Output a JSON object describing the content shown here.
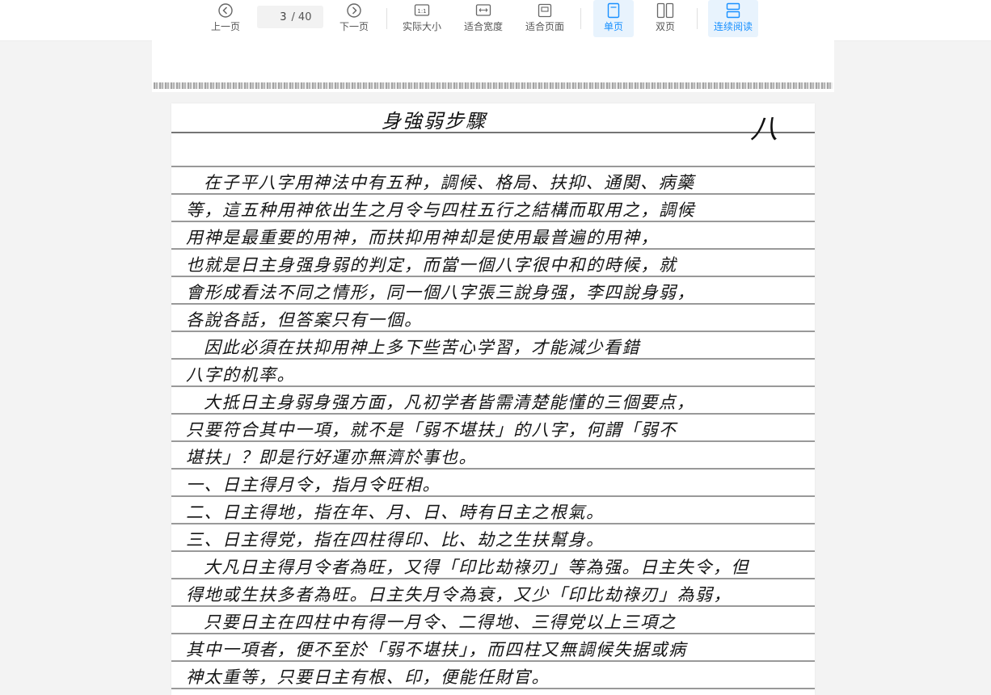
{
  "toolbar": {
    "prev_label": "上一页",
    "next_label": "下一页",
    "current_page": "3",
    "separator": "/",
    "total_pages": "40",
    "actual_size_label": "实际大小",
    "actual_size_glyph": "1:1",
    "fit_width_label": "适合宽度",
    "fit_page_label": "适合页面",
    "single_page_label": "单页",
    "double_page_label": "双页",
    "continuous_label": "连续阅读",
    "active_mode": "单页",
    "accent_color": "#1890ff"
  },
  "document": {
    "title": "身強弱步驟",
    "page_number": "八",
    "lines": [
      "在子平八字用神法中有五种，調候、格局、扶抑、通関、病藥",
      "等，這五种用神依出生之月令与四柱五行之結構而取用之，調候",
      "用神是最重要的用神，而扶抑用神却是使用最普遍的用神，",
      "也就是日主身强身弱的判定，而當一個八字很中和的時候，就",
      "會形成看法不同之情形，同一個八字張三說身强，李四說身弱，",
      "各說各話，但答案只有一個。",
      "因此必須在扶抑用神上多下些苦心学習，才能減少看錯",
      "八字的机率。",
      "大抵日主身弱身强方面，凡初学者皆需清楚能懂的三個要点，",
      "只要符合其中一項，就不是「弱不堪扶」的八字，何謂「弱不",
      "堪扶」？即是行好運亦無濟於事也。",
      "一、日主得月令，指月令旺相。",
      "二、日主得地，指在年、月、日、時有日主之根氣。",
      "三、日主得党，指在四柱得印、比、劫之生扶幫身。",
      "大凡日主得月令者為旺，又得「印比劫祿刃」等為强。日主失令，但",
      "得地或生扶多者為旺。日主失月令為衰，又少「印比劫祿刃」為弱，",
      "只要日主在四柱中有得一月令、二得地、三得党以上三項之",
      "其中一項者，便不至於「弱不堪扶」，而四柱又無調候失据或病",
      "神太重等，只要日主有根、印，便能任財官。"
    ]
  }
}
